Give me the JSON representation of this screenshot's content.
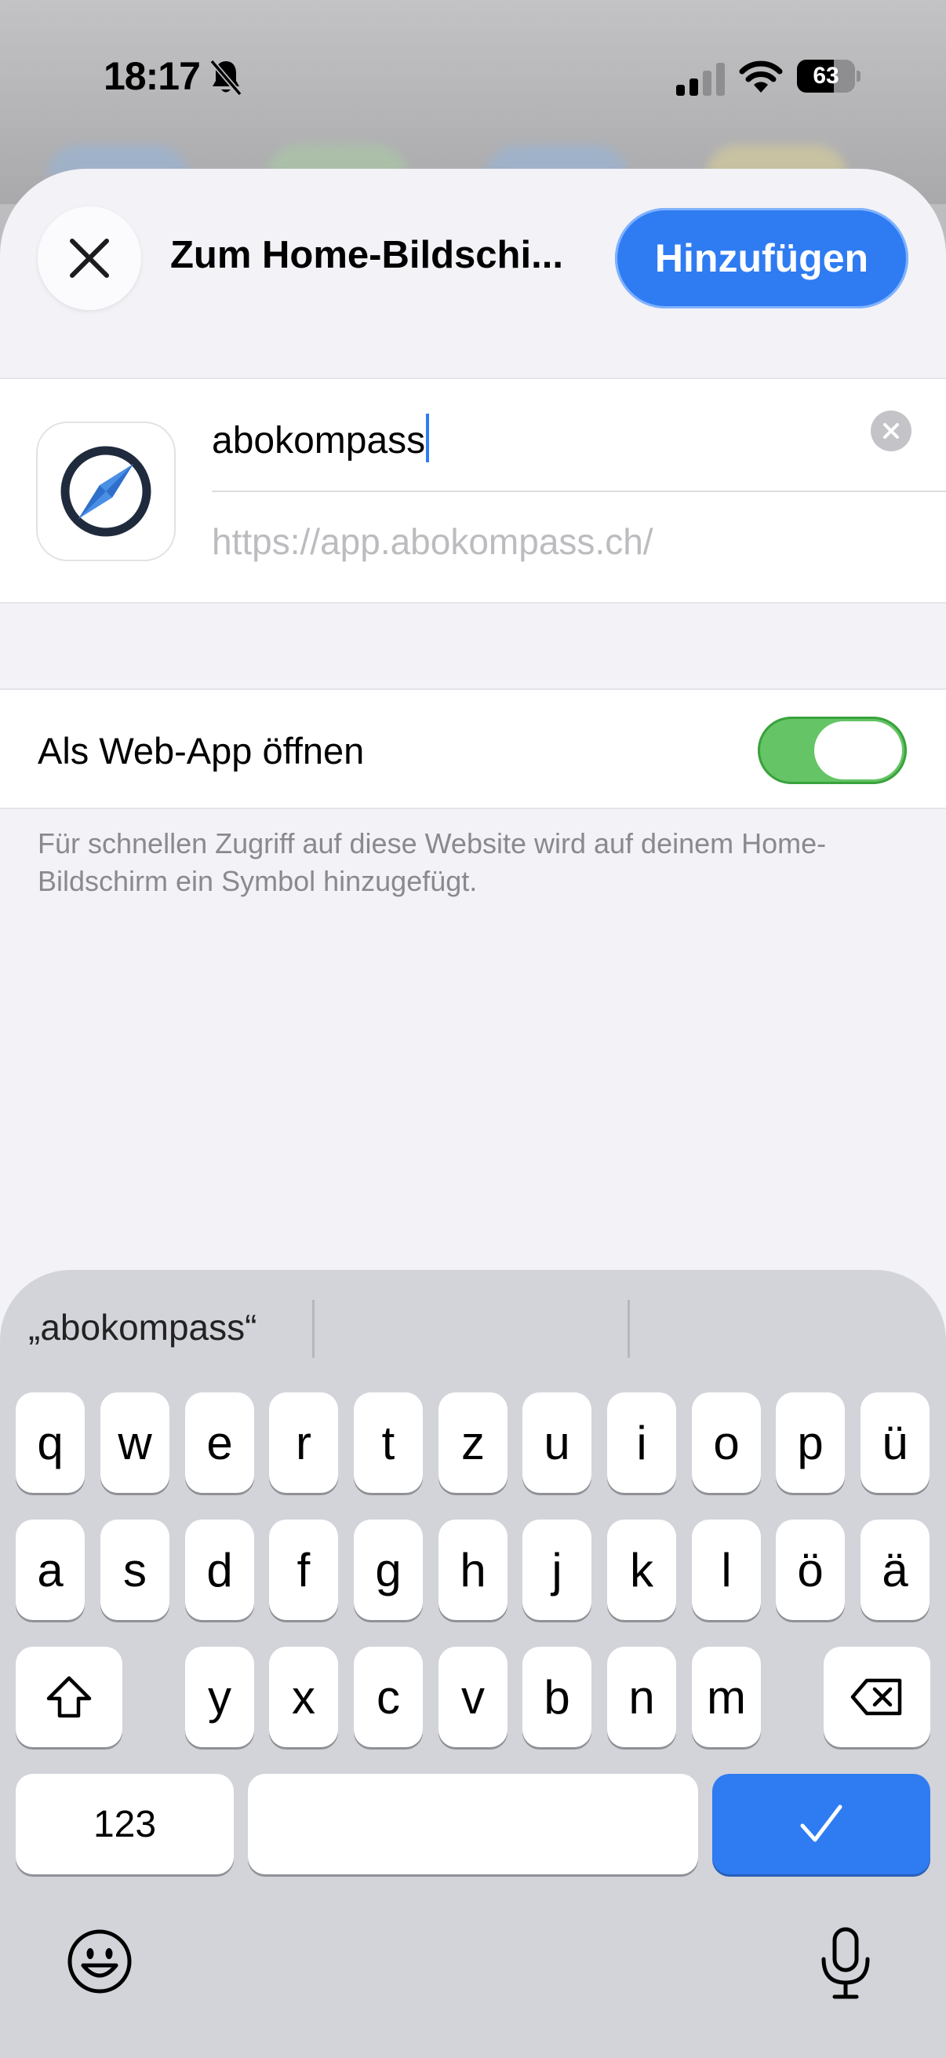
{
  "status_bar": {
    "time": "18:17",
    "battery": "63",
    "battery_level": 0.63
  },
  "sheet": {
    "title": "Zum Home-Bildschi...",
    "add_button": "Hinzufügen",
    "name_value": "abokompass",
    "url": "https://app.abokompass.ch/",
    "webapp_label": "Als Web-App öffnen",
    "webapp_enabled": true,
    "footnote": "Für schnellen Zugriff auf diese Website wird auf deinem Home-Bildschirm ein Symbol hinzugefügt."
  },
  "keyboard": {
    "suggestions": [
      "„abokompass“",
      "",
      ""
    ],
    "row1": [
      "q",
      "w",
      "e",
      "r",
      "t",
      "z",
      "u",
      "i",
      "o",
      "p",
      "ü"
    ],
    "row2": [
      "a",
      "s",
      "d",
      "f",
      "g",
      "h",
      "j",
      "k",
      "l",
      "ö",
      "ä"
    ],
    "row3": [
      "y",
      "x",
      "c",
      "v",
      "b",
      "n",
      "m"
    ],
    "numbers_key": "123"
  },
  "colors": {
    "accent": "#2f7bf2",
    "toggle_on": "#65c466"
  },
  "icons": [
    "close-icon",
    "compass-icon",
    "clear-icon",
    "shift-icon",
    "delete-icon",
    "checkmark-icon",
    "emoji-icon",
    "microphone-icon",
    "bell-slash-icon",
    "cellular-signal-icon",
    "wifi-icon",
    "battery-icon"
  ]
}
